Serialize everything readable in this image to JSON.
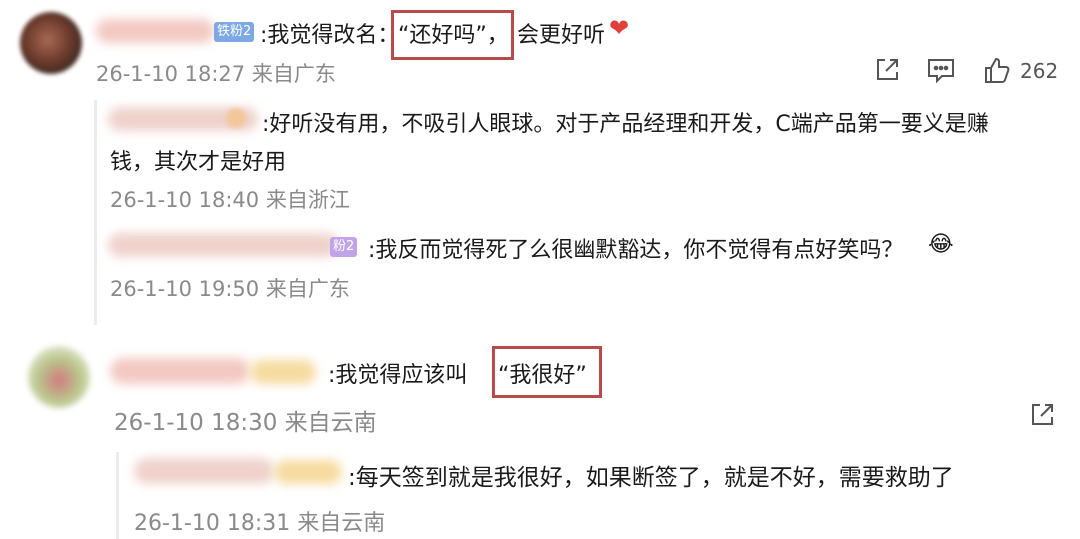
{
  "comments": [
    {
      "badge": "铁粉2",
      "text_prefix": ":我觉得改名：",
      "quoted": "“还好吗”，",
      "text_suffix": "会更好听",
      "heart": "❤",
      "meta": "26-1-10 18:27 来自广东",
      "likes": "262",
      "replies": [
        {
          "line1": ":好听没有用，不吸引人眼球。对于产品经理和开发，C端产品第一要义是赚",
          "line2": "钱，其次才是好用",
          "meta": "26-1-10 18:40 来自浙江"
        },
        {
          "badge": "粉2",
          "text": ":我反而觉得死了么很幽默豁达，你不觉得有点好笑吗？",
          "emoji": "😂",
          "meta": "26-1-10 19:50 来自广东"
        }
      ]
    },
    {
      "text_prefix": ":我觉得应该叫",
      "quoted": "“我很好”",
      "meta": "26-1-10 18:30 来自云南",
      "replies": [
        {
          "text": ":每天签到就是我很好，如果断签了，就是不好，需要救助了",
          "meta": "26-1-10 18:31 来自云南"
        }
      ]
    }
  ],
  "colors": {
    "highlight": "#b84a4a",
    "meta": "#8a8a8a",
    "heart": "#e0403a"
  },
  "icons": [
    "share-icon",
    "comment-icon",
    "like-icon"
  ]
}
